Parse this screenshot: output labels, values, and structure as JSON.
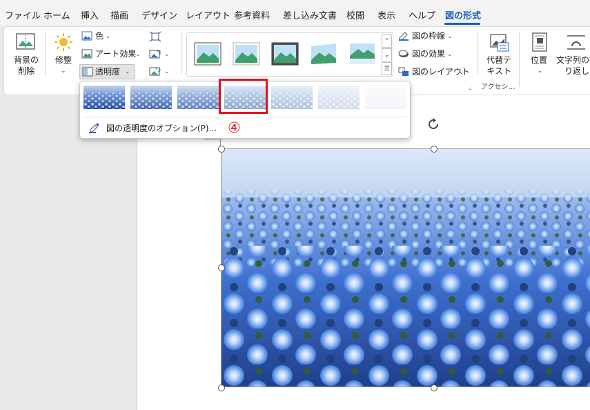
{
  "menu": {
    "tabs": [
      "ファイル",
      "ホーム",
      "挿入",
      "描画",
      "デザイン",
      "レイアウト",
      "参考資料",
      "差し込み文書",
      "校閲",
      "表示",
      "ヘルプ",
      "図の形式"
    ],
    "active_tab": "図の形式"
  },
  "ribbon": {
    "remove_background": "背景の\n削除",
    "corrections": "修整",
    "color": "色",
    "artistic_effects": "アート効果",
    "transparency": "透明度",
    "picture_border": "図の枠線",
    "picture_effects": "図の効果",
    "picture_layout": "図のレイアウト",
    "alt_text": "代替テ\nキスト",
    "accessibility_group": "アクセシ…",
    "position": "位置",
    "wrap_text": "文字列の折\nり返し"
  },
  "transparency_menu": {
    "presets_percent": [
      0,
      15,
      30,
      50,
      65,
      80,
      95
    ],
    "highlighted_index": 3,
    "options_label": "図の透明度のオプション(P)..."
  },
  "annotation": {
    "step_marker": "④",
    "color": "#e8101a"
  },
  "colors": {
    "accent": "#185abd",
    "highlight": "#e8101a"
  }
}
